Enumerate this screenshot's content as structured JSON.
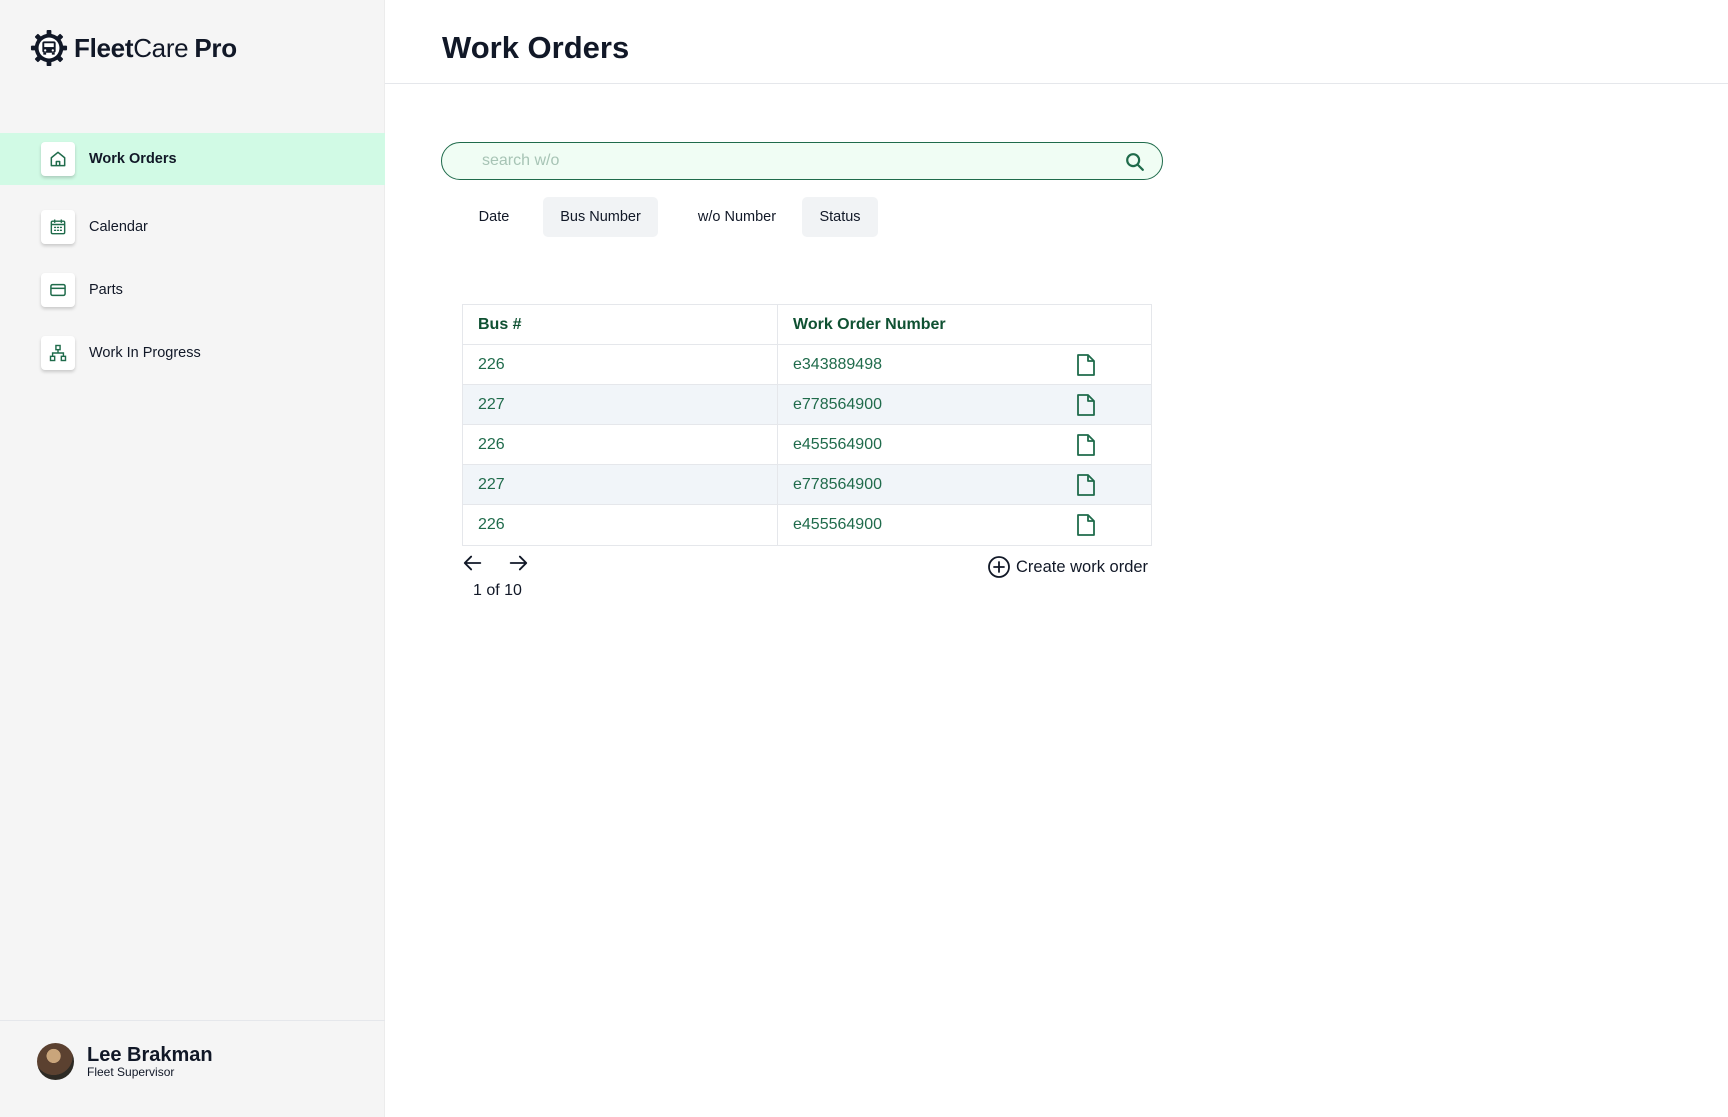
{
  "app": {
    "name_part1": "Fleet",
    "name_part2": "Care",
    "name_part3": "Pro"
  },
  "sidebar": {
    "items": [
      {
        "label": "Work Orders",
        "icon": "home-icon",
        "active": true
      },
      {
        "label": "Calendar",
        "icon": "calendar-icon",
        "active": false
      },
      {
        "label": "Parts",
        "icon": "card-icon",
        "active": false
      },
      {
        "label": "Work In Progress",
        "icon": "hierarchy-icon",
        "active": false
      }
    ]
  },
  "user": {
    "name": "Lee Brakman",
    "role": "Fleet Supervisor"
  },
  "header": {
    "title": "Work Orders"
  },
  "search": {
    "placeholder": "search w/o",
    "value": ""
  },
  "filters": [
    {
      "label": "Date"
    },
    {
      "label": "Bus Number"
    },
    {
      "label": "w/o Number"
    },
    {
      "label": "Status"
    }
  ],
  "table": {
    "columns": [
      "Bus #",
      "Work Order Number"
    ],
    "rows": [
      {
        "bus": "226",
        "work_order": "e343889498"
      },
      {
        "bus": "227",
        "work_order": "e778564900"
      },
      {
        "bus": "226",
        "work_order": "e455564900"
      },
      {
        "bus": "227",
        "work_order": "e778564900"
      },
      {
        "bus": "226",
        "work_order": "e455564900"
      }
    ]
  },
  "pagination": {
    "label": "1 of 10",
    "current": 1,
    "total": 10
  },
  "actions": {
    "create_label": "Create work order"
  },
  "colors": {
    "accent": "#1f6b4b",
    "active_nav": "#d1fae5",
    "sidebar_bg": "#f5f5f5"
  }
}
